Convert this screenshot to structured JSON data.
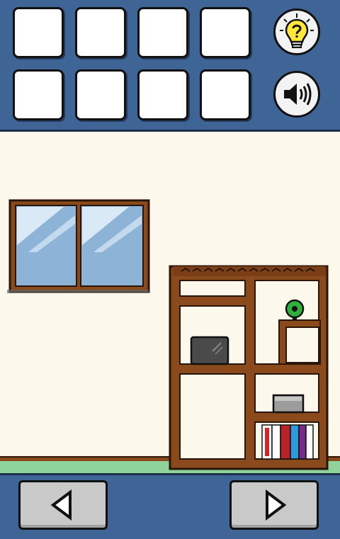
{
  "inventory": {
    "slots": [
      {
        "row": 1,
        "col": 1,
        "item": ""
      },
      {
        "row": 1,
        "col": 2,
        "item": ""
      },
      {
        "row": 1,
        "col": 3,
        "item": ""
      },
      {
        "row": 1,
        "col": 4,
        "item": ""
      },
      {
        "row": 2,
        "col": 1,
        "item": ""
      },
      {
        "row": 2,
        "col": 2,
        "item": ""
      },
      {
        "row": 2,
        "col": 3,
        "item": ""
      },
      {
        "row": 2,
        "col": 4,
        "item": ""
      }
    ]
  },
  "controls": {
    "hint_button_icon": "lightbulb-question-icon",
    "sound_button_icon": "speaker-icon",
    "left_arrow_icon": "arrow-left-icon",
    "right_arrow_icon": "arrow-right-icon"
  },
  "room": {
    "objects": [
      "window",
      "bookshelf",
      "laptop",
      "green-ball",
      "gray-box",
      "books"
    ]
  },
  "colors": {
    "ui_blue": "#3f6496",
    "wall": "#fdf8ec",
    "wood": "#8a4a1c",
    "glass": "#8db4d6",
    "floor_green": "#8fd39b",
    "hint_yellow": "#ffe83a"
  }
}
